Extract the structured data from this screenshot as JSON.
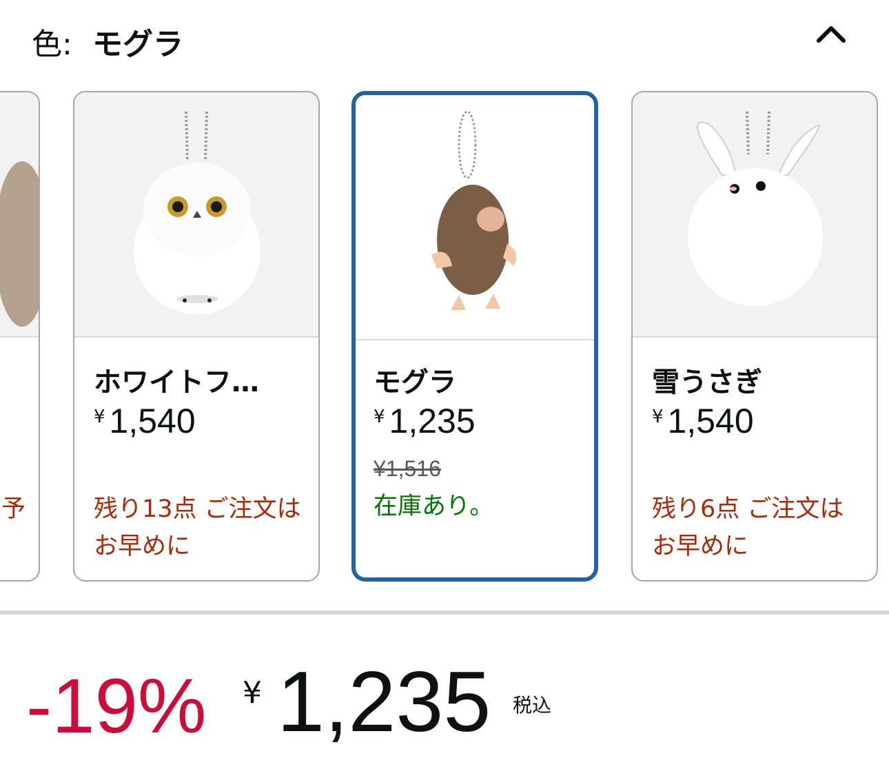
{
  "header": {
    "label": "色:",
    "selected_color": "モグラ"
  },
  "variants": [
    {
      "name": "",
      "price_yen": "¥",
      "price": "",
      "stock": "予",
      "stock_type": "low"
    },
    {
      "name": "ホワイトフ…",
      "price_yen": "¥",
      "price": "1,540",
      "stock": "残り13点 ご注文はお早めに",
      "stock_type": "low",
      "image": "snowy-owl-plush"
    },
    {
      "name": "モグラ",
      "price_yen": "¥",
      "price": "1,235",
      "was_price": "¥1,516",
      "stock": "在庫あり。",
      "stock_type": "ok",
      "selected": true,
      "image": "mole-plush"
    },
    {
      "name": "雪うさぎ",
      "price_yen": "¥",
      "price": "1,540",
      "stock": "残り6点 ご注文はお早めに",
      "stock_type": "low",
      "image": "snow-rabbit-plush"
    }
  ],
  "price_summary": {
    "discount": "-19%",
    "currency": "¥",
    "price": "1,235",
    "tax_note": "税込"
  },
  "colors": {
    "selected_border": "#2162a1",
    "discount": "#cc0c39",
    "low_stock": "#b12704",
    "in_stock": "#007600"
  },
  "icons": {
    "collapse": "chevron-up-icon"
  }
}
